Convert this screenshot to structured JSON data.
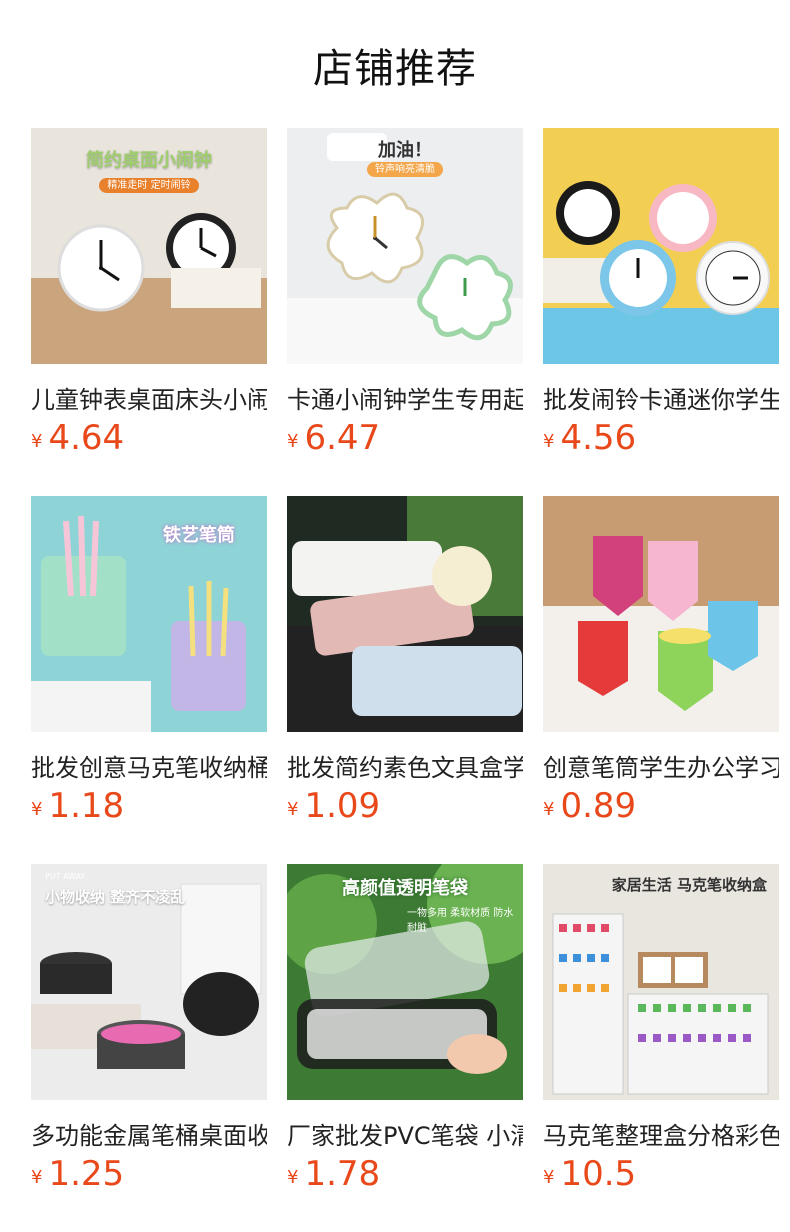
{
  "header": {
    "title": "店铺推荐"
  },
  "currency": "¥",
  "products": [
    {
      "name": "儿童钟表桌面床头小闹钟",
      "price": "4.64",
      "image_text": "简约桌面小闹钟",
      "image_subtext": "精准走时 定时闹铃"
    },
    {
      "name": "卡通小闹钟学生专用起床",
      "price": "6.47",
      "image_text": "加油！",
      "image_subtext": "铃声响亮清脆"
    },
    {
      "name": "批发闹铃卡通迷你学生",
      "price": "4.56",
      "image_text": "",
      "image_subtext": ""
    },
    {
      "name": "批发创意马克笔收纳桶",
      "price": "1.18",
      "image_text": "铁艺笔筒",
      "image_subtext": ""
    },
    {
      "name": "批发简约素色文具盒学生",
      "price": "1.09",
      "image_text": "",
      "image_subtext": ""
    },
    {
      "name": "创意笔筒学生办公学习",
      "price": "0.89",
      "image_text": "",
      "image_subtext": ""
    },
    {
      "name": "多功能金属笔桶桌面收纳",
      "price": "1.25",
      "image_text": "小物收纳 整齐不凌乱",
      "image_subtext": "PUT AWAY"
    },
    {
      "name": "厂家批发PVC笔袋 小清新",
      "price": "1.78",
      "image_text": "高颜值透明笔袋",
      "image_subtext": "一物多用 柔软材质 防水耐脏"
    },
    {
      "name": "马克笔整理盒分格彩色",
      "price": "10.5",
      "image_text": "家居生活 马克笔收纳盒",
      "image_subtext": ""
    }
  ],
  "colors": {
    "price": "#e8481a",
    "title": "#111111"
  }
}
